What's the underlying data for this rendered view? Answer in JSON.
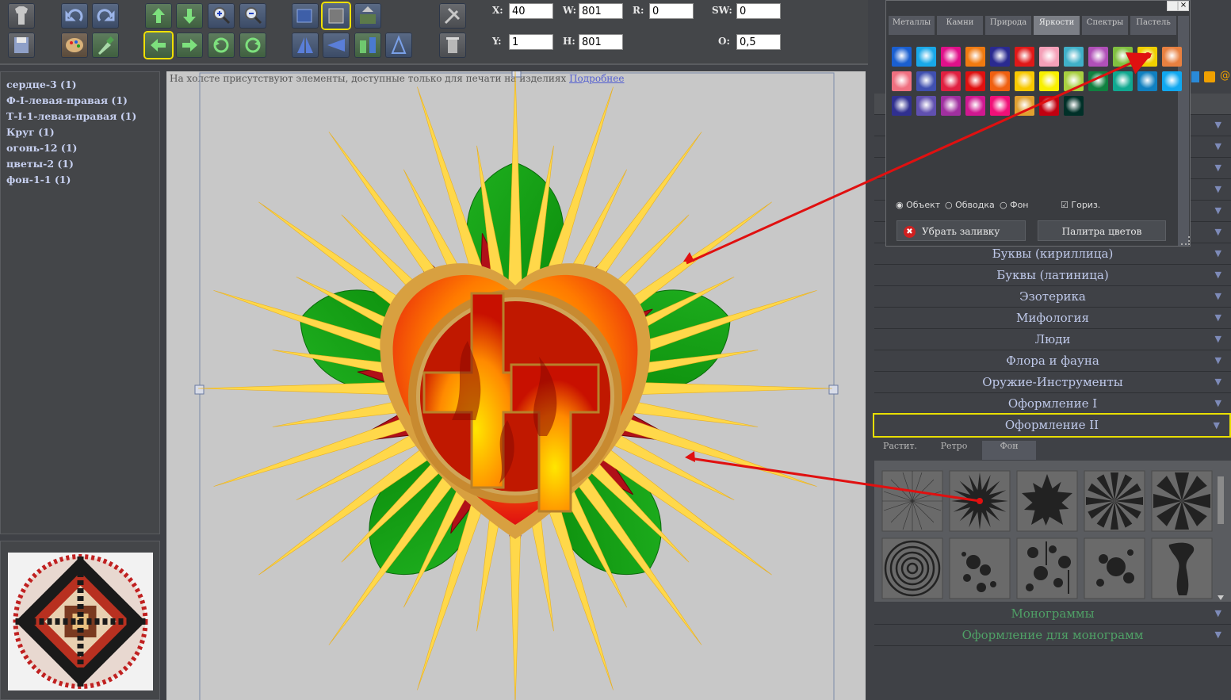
{
  "toolbar": {
    "coords": {
      "x_label": "X:",
      "x": "40",
      "w_label": "W:",
      "w": "801",
      "r_label": "R:",
      "r": "0",
      "sw_label": "SW:",
      "sw": "0",
      "y_label": "Y:",
      "y": "1",
      "h_label": "H:",
      "h": "801",
      "o_label": "O:",
      "o": "0,5"
    }
  },
  "layers": {
    "items": [
      "сердце-3 (1)",
      "Ф-I-левая-правая (1)",
      "Т-I-1-левая-правая (1)",
      "Круг (1)",
      "огонь-12 (1)",
      "цветы-2 (1)",
      "фон-1-1 (1)"
    ]
  },
  "canvas": {
    "notice": "На холсте присутствуют элементы, доступные только для печати на изделиях",
    "notice_link": "Подробнее"
  },
  "palette": {
    "tabs": [
      "Металлы",
      "Камни",
      "Природа",
      "Яркости",
      "Спектры",
      "Пастель"
    ],
    "active_tab": "Яркости",
    "radio_object": "Объект",
    "radio_stroke": "Обводка",
    "radio_bg": "Фон",
    "check_horiz": "Гориз.",
    "remove_fill": "Убрать заливку",
    "color_palette": "Палитра цветов"
  },
  "categories": [
    "Буквы (кириллица)",
    "Буквы (латиница)",
    "Эзотерика",
    "Мифология",
    "Люди",
    "Флора и фауна",
    "Оружие-Инструменты",
    "Оформление I",
    "Оформление II"
  ],
  "selected_category": "Оформление II",
  "shape_tabs": [
    "Растит.",
    "Ретро",
    "Фон"
  ],
  "bottom_categories": [
    "Монограммы",
    "Оформление для монограмм"
  ],
  "colors": {
    "accent": "#e8df00",
    "arrow": "#e01010"
  }
}
